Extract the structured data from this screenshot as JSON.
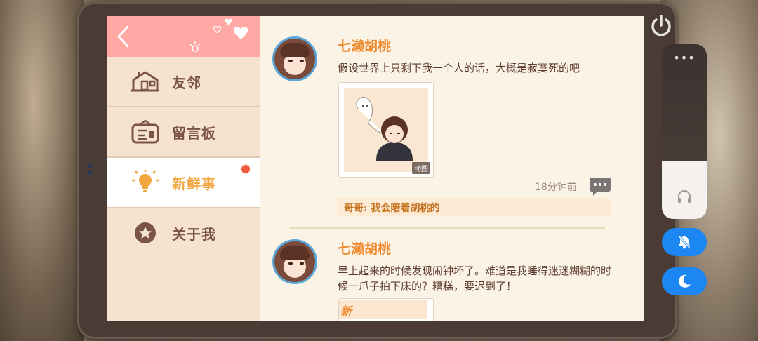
{
  "sidebar": {
    "items": [
      {
        "label": "友邻",
        "icon": "house-icon",
        "active": false
      },
      {
        "label": "留言板",
        "icon": "message-board-icon",
        "active": false
      },
      {
        "label": "新鲜事",
        "icon": "lightbulb-icon",
        "active": true,
        "has_badge": true
      },
      {
        "label": "关于我",
        "icon": "star-icon",
        "active": false
      }
    ]
  },
  "feed": {
    "posts": [
      {
        "author": "七濑胡桃",
        "text": "假设世界上只剩下我一个人的话，大概是寂寞死的吧",
        "media_tag": "动图",
        "time": "18分钟前",
        "comment": "哥哥: 我会陪着胡桃的"
      },
      {
        "author": "七濑胡桃",
        "text": "早上起来的时候发现闹钟坏了。难道是我睡得迷迷糊糊的时候一爪子拍下床的？糟糕，要迟到了！",
        "media_tag": "新"
      }
    ]
  },
  "controls": {
    "more_dots": "•••",
    "volume_level": 0.33
  },
  "colors": {
    "header_pink": "#ffa8a4",
    "accent_orange": "#ef8a2d",
    "button_blue": "#1c86f2"
  }
}
